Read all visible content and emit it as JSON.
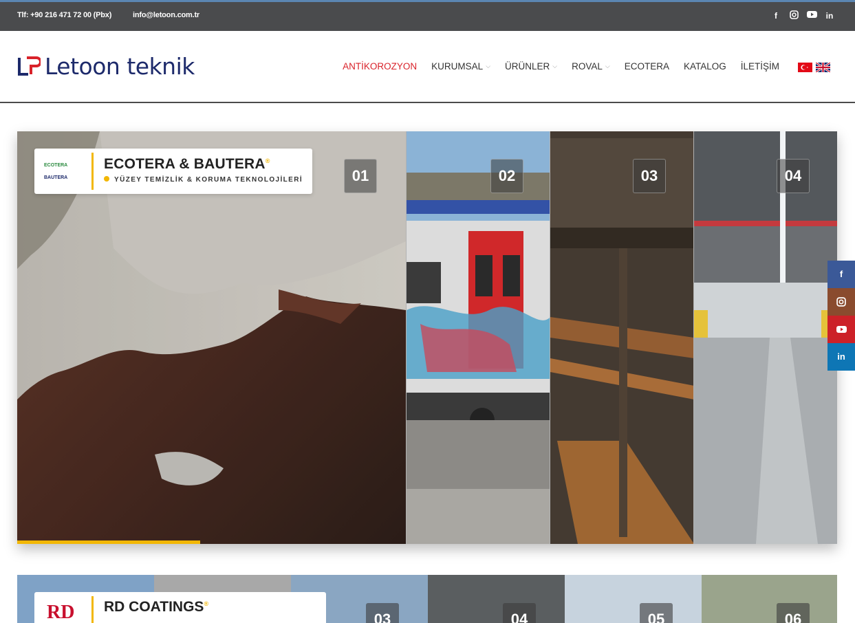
{
  "topbar": {
    "phone": "Tlf: +90 216 471 72 00 (Pbx)",
    "email": "info@letoon.com.tr",
    "social": [
      "facebook-icon",
      "instagram-icon",
      "youtube-icon",
      "linkedin-icon"
    ]
  },
  "header": {
    "logo_text": "Letoon teknik",
    "nav": [
      {
        "label": "ANTİKOROZYON",
        "active": true
      },
      {
        "label": "KURUMSAL",
        "dropdown": true
      },
      {
        "label": "ÜRÜNLER",
        "dropdown": true
      },
      {
        "label": "ROVAL",
        "dropdown": true
      },
      {
        "label": "ECOTERA"
      },
      {
        "label": "KATALOG"
      },
      {
        "label": "İLETİŞİM"
      }
    ],
    "languages": [
      "tr-flag-icon",
      "uk-flag-icon"
    ],
    "colors": {
      "active": "#d9222a",
      "brand": "#1d2a6b"
    }
  },
  "slider1": {
    "title": "ECOTERA & BAUTERA",
    "reg": "®",
    "subtitle": "YÜZEY TEMİZLİK & KORUMA TEKNOLOJİLERİ",
    "logo_lines": [
      "ECOTERA",
      "BAUTERA"
    ],
    "panels": [
      "01",
      "02",
      "03",
      "04"
    ],
    "progress": 0.47,
    "accent": "#f2b705"
  },
  "sidesocial": [
    "facebook-icon",
    "instagram-icon",
    "youtube-icon",
    "linkedin-icon"
  ],
  "slider2": {
    "title": "RD COATINGS",
    "reg": "®",
    "logo": "RD",
    "panels": [
      "03",
      "04",
      "05",
      "06"
    ]
  }
}
